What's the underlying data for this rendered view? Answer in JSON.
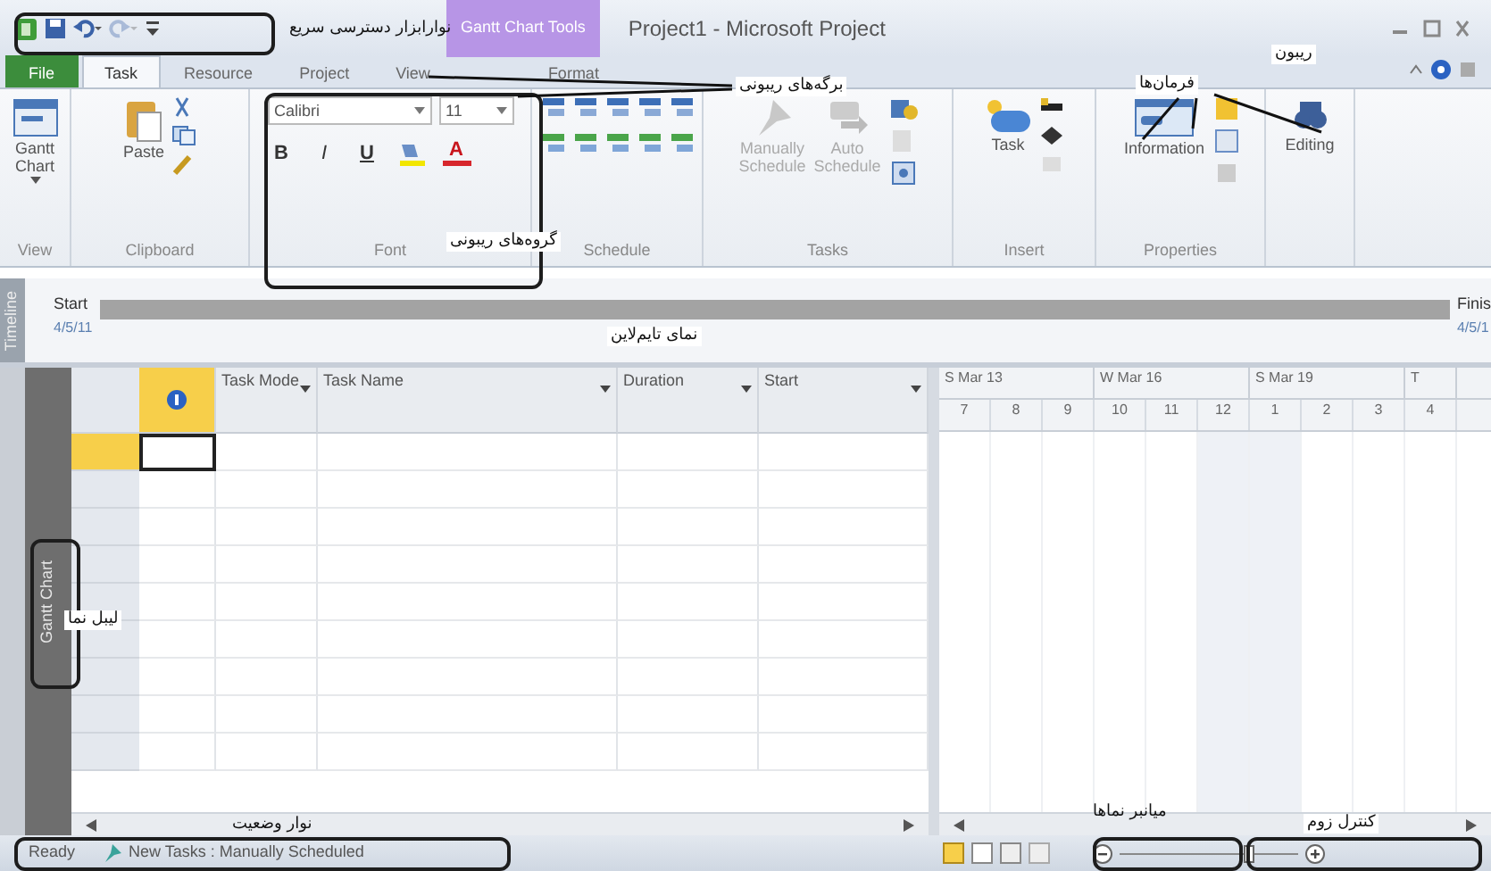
{
  "quick_access_toolbar": {
    "items": [
      {
        "kind": "app",
        "disabled": false
      },
      {
        "kind": "save",
        "disabled": false
      },
      {
        "kind": "undo",
        "disabled": false
      },
      {
        "kind": "redo",
        "disabled": true
      },
      {
        "kind": "customize",
        "disabled": false
      }
    ]
  },
  "contextual_tab": "Gantt Chart Tools",
  "window": {
    "title": "Project1 - Microsoft Project"
  },
  "ribbon_tabs": [
    {
      "label": "File",
      "kind": "backstage",
      "selected": false
    },
    {
      "label": "Task",
      "kind": "tab",
      "selected": true
    },
    {
      "label": "Resource",
      "kind": "tab",
      "selected": false
    },
    {
      "label": "Project",
      "kind": "tab",
      "selected": false
    },
    {
      "label": "View",
      "kind": "tab",
      "selected": false
    },
    {
      "label": "Format",
      "kind": "contextual",
      "selected": false
    }
  ],
  "ribbon_groups": [
    {
      "label": "View",
      "kind": "view",
      "commands": [
        {
          "label": "Gantt Chart",
          "disabled": false
        }
      ]
    },
    {
      "label": "Clipboard",
      "kind": "clipboard",
      "commands": [
        {
          "label": "Paste",
          "disabled": false
        }
      ]
    },
    {
      "label": "Font",
      "kind": "font",
      "font_name": "Calibri",
      "font_size": "11",
      "styles": [
        "B",
        "I",
        "U"
      ],
      "color_letter": "A"
    },
    {
      "label": "Schedule",
      "kind": "schedule"
    },
    {
      "label": "Tasks",
      "kind": "tasks",
      "commands": [
        {
          "label": "Manually Schedule",
          "disabled": true
        },
        {
          "label": "Auto Schedule",
          "disabled": true
        }
      ]
    },
    {
      "label": "Insert",
      "kind": "insert",
      "commands": [
        {
          "label": "Task",
          "disabled": false
        }
      ]
    },
    {
      "label": "Properties",
      "kind": "properties",
      "commands": [
        {
          "label": "Information",
          "disabled": false
        }
      ]
    },
    {
      "kind": "editing",
      "commands": [
        {
          "label": "Editing",
          "disabled": false
        }
      ]
    }
  ],
  "timeline": {
    "tab": "Timeline",
    "start_label": "Start",
    "start_date": "4/5/11",
    "finish_label": "Finis",
    "finish_date": "4/5/1"
  },
  "view_bar": {
    "label": "Gantt Chart"
  },
  "table": {
    "columns": [
      {
        "kind": "indicator"
      },
      {
        "kind": "text",
        "label": "Task Mode"
      },
      {
        "kind": "text",
        "label": "Task Name"
      },
      {
        "kind": "text",
        "label": "Duration"
      },
      {
        "kind": "text",
        "label": "Start"
      }
    ],
    "rows": [
      {
        "selected": true
      },
      {
        "selected": false
      },
      {
        "selected": false
      },
      {
        "selected": false
      },
      {
        "selected": false
      },
      {
        "selected": false
      },
      {
        "selected": false
      },
      {
        "selected": false
      },
      {
        "selected": false
      }
    ]
  },
  "gantt": {
    "weeks": [
      "S Mar 13",
      "W Mar 16",
      "S Mar 19",
      "T"
    ],
    "days": [
      "7",
      "8",
      "9",
      "10",
      "11",
      "12",
      "1",
      "2",
      "3",
      "4"
    ]
  },
  "status_bar": {
    "ready": "Ready",
    "new_tasks": "New Tasks : Manually Scheduled"
  },
  "annotations": [
    {
      "text": "نوارابزار دسترسی سریع"
    },
    {
      "text": "برگه‌های ریبونی"
    },
    {
      "text": "ریبون"
    },
    {
      "text": "فرمان‌ها"
    },
    {
      "text": "گروه‌های ریبونی"
    },
    {
      "text": "نمای تایم‌لاین"
    },
    {
      "text": "لیبل نما"
    },
    {
      "text": "نوار وضعیت"
    },
    {
      "text": "میانبر نماها"
    },
    {
      "text": "کنترل زوم"
    }
  ]
}
